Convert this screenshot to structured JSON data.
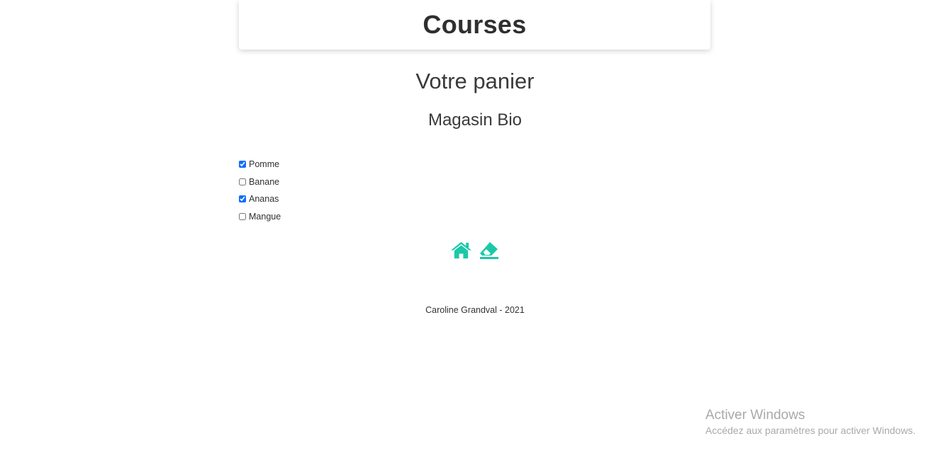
{
  "header": {
    "title": "Courses"
  },
  "main": {
    "heading": "Votre panier",
    "store": "Magasin Bio",
    "items": [
      {
        "label": "Pomme",
        "checked": true
      },
      {
        "label": "Banane",
        "checked": false
      },
      {
        "label": "Ananas",
        "checked": true
      },
      {
        "label": "Mangue",
        "checked": false
      }
    ],
    "actions": [
      {
        "icon": "home-icon"
      },
      {
        "icon": "eraser-icon"
      }
    ]
  },
  "footer": {
    "text": "Caroline Grandval - 2021"
  },
  "windows_watermark": {
    "title": "Activer Windows",
    "subtitle": "Accédez aux paramètres pour activer Windows."
  },
  "colors": {
    "accent": "#1ac9a8",
    "checkbox": "#0d6efd"
  }
}
